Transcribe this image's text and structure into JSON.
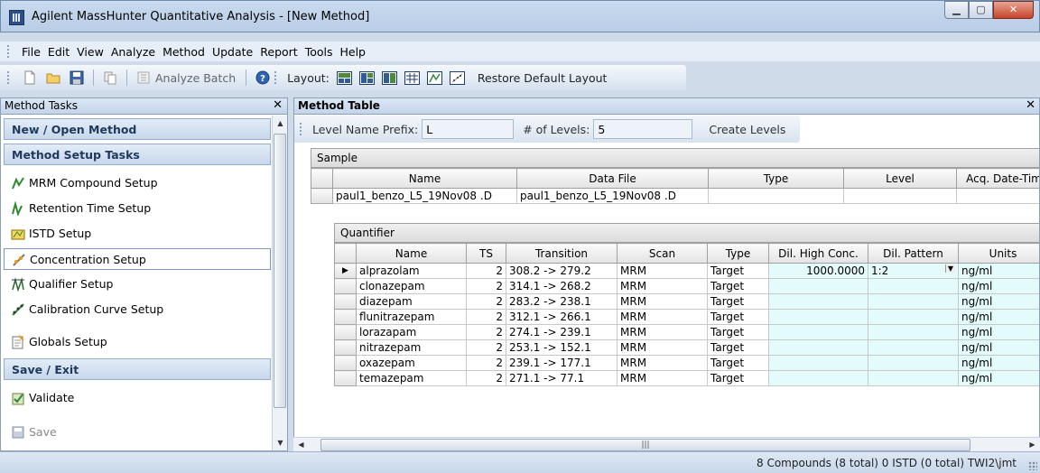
{
  "window": {
    "title": "Agilent MassHunter Quantitative Analysis - [New Method]",
    "minimize": "▁",
    "maximize": "▢",
    "close": "✕"
  },
  "menu": [
    "File",
    "Edit",
    "View",
    "Analyze",
    "Method",
    "Update",
    "Report",
    "Tools",
    "Help"
  ],
  "toolbar": {
    "analyze_batch": "Analyze Batch",
    "layout_label": "Layout:",
    "restore_layout": "Restore Default Layout"
  },
  "method_tasks": {
    "title": "Method Tasks",
    "close": "✕",
    "groups": [
      "New / Open Method",
      "Method Setup Tasks",
      "Save / Exit"
    ],
    "items": [
      {
        "label": "MRM Compound Setup",
        "icon": "compound-icon"
      },
      {
        "label": "Retention Time Setup",
        "icon": "retention-icon"
      },
      {
        "label": "ISTD Setup",
        "icon": "istd-icon"
      },
      {
        "label": "Concentration Setup",
        "icon": "concentration-icon"
      },
      {
        "label": "Qualifier Setup",
        "icon": "qualifier-icon"
      },
      {
        "label": "Calibration Curve Setup",
        "icon": "calibration-icon"
      },
      {
        "label": "Globals Setup",
        "icon": "globals-icon"
      },
      {
        "label": "Validate",
        "icon": "validate-icon"
      },
      {
        "label": "Save",
        "icon": "save-icon"
      }
    ]
  },
  "method_table": {
    "title": "Method Table",
    "close": "✕",
    "level_name_prefix_label": "Level Name Prefix:",
    "level_name_prefix_value": "L",
    "num_levels_label": "# of Levels:",
    "num_levels_value": "5",
    "create_levels": "Create Levels",
    "sample": {
      "band": "Sample",
      "columns": [
        "Name",
        "Data File",
        "Type",
        "Level",
        "Acq. Date-Tim"
      ],
      "row": [
        "paul1_benzo_L5_19Nov08 .D",
        "paul1_benzo_L5_19Nov08 .D",
        "",
        "",
        ""
      ]
    },
    "quantifier": {
      "band": "Quantifier",
      "columns": [
        "Name",
        "TS",
        "Transition",
        "Scan",
        "Type",
        "Dil. High Conc.",
        "Dil. Pattern",
        "Units"
      ],
      "rows": [
        [
          "alprazolam",
          "2",
          "308.2 -> 279.2",
          "MRM",
          "Target",
          "1000.0000",
          "1:2",
          "ng/ml"
        ],
        [
          "clonazepam",
          "2",
          "314.1 -> 268.2",
          "MRM",
          "Target",
          "",
          "",
          "ng/ml"
        ],
        [
          "diazepam",
          "2",
          "283.2 -> 238.1",
          "MRM",
          "Target",
          "",
          "",
          "ng/ml"
        ],
        [
          "flunitrazepam",
          "2",
          "312.1 -> 266.1",
          "MRM",
          "Target",
          "",
          "",
          "ng/ml"
        ],
        [
          "lorazapam",
          "2",
          "274.1 -> 239.1",
          "MRM",
          "Target",
          "",
          "",
          "ng/ml"
        ],
        [
          "nitrazepam",
          "2",
          "253.1 -> 152.1",
          "MRM",
          "Target",
          "",
          "",
          "ng/ml"
        ],
        [
          "oxazepam",
          "2",
          "239.1 -> 177.1",
          "MRM",
          "Target",
          "",
          "",
          "ng/ml"
        ],
        [
          "temazepam",
          "2",
          "271.1 -> 77.1",
          "MRM",
          "Target",
          "",
          "",
          "ng/ml"
        ]
      ]
    }
  },
  "status": {
    "text": "8 Compounds (8 total) 0 ISTD (0 total)   TWI2\\jmt"
  }
}
